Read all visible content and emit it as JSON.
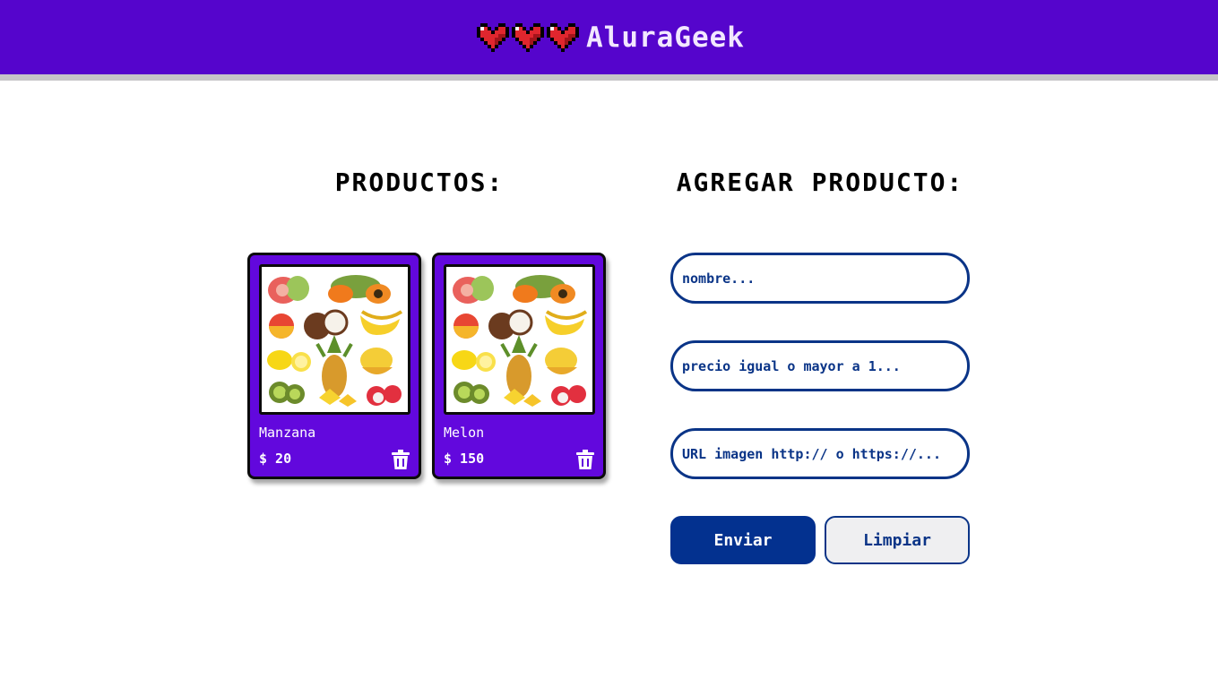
{
  "header": {
    "brand": "AluraGeek",
    "icons": [
      "heart-icon",
      "heart-icon",
      "heart-icon"
    ],
    "color": "#5505cc"
  },
  "products_section": {
    "title": "PRODUCTOS:",
    "items": [
      {
        "name": "Manzana",
        "price": "$ 20",
        "image": "fruit-assortment-image"
      },
      {
        "name": "Melon",
        "price": "$ 150",
        "image": "fruit-assortment-image"
      }
    ],
    "card_color": "#6208dd"
  },
  "form": {
    "title": "AGREGAR PRODUCTO:",
    "name_placeholder": "nombre...",
    "price_placeholder": "precio igual o mayor a 1...",
    "url_placeholder": "URL imagen http:// o https://...",
    "submit_label": "Enviar",
    "clear_label": "Limpiar",
    "accent": "#0a3487"
  }
}
